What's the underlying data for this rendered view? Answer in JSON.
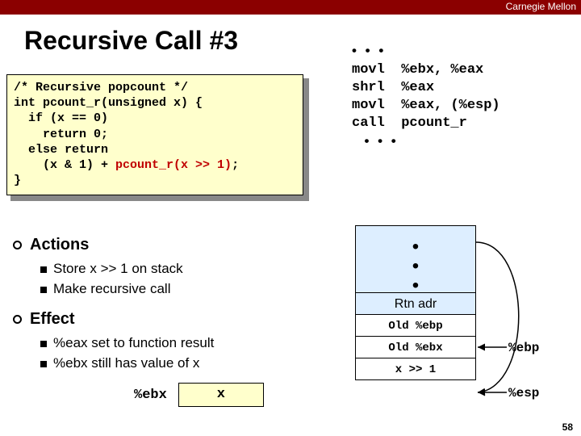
{
  "header": {
    "brand": "Carnegie Mellon"
  },
  "title": "Recursive Call #3",
  "code": {
    "l1": "/* Recursive popcount */",
    "l2": "int pcount_r(unsigned x) {",
    "l3": "  if (x == 0)",
    "l4": "    return 0;",
    "l5": "  else return",
    "l6a": "    (x & 1) + ",
    "l6b": "pcount_r(x >> 1)",
    "l6c": ";",
    "l7": "}"
  },
  "asm": {
    "dots_top": "• • •",
    "l1": "movl  %ebx, %eax",
    "l2": "shrl  %eax",
    "l3": "movl  %eax, (%esp)",
    "l4": "call  pcount_r",
    "dots_bot": "  • • •"
  },
  "sections": {
    "actions": {
      "heading": "Actions",
      "b1": "Store x >> 1 on stack",
      "b2": "Make recursive call"
    },
    "effect": {
      "heading": "Effect",
      "b1": "%eax set to function result",
      "b2": "%ebx still has value of x"
    }
  },
  "reg": {
    "label": "%ebx",
    "value": "x"
  },
  "stack": {
    "dots": "•\n•\n•",
    "rtn": "Rtn adr",
    "oldebp": "Old %ebp",
    "oldebx": "Old %ebx",
    "arg": "x >> 1"
  },
  "ptr": {
    "ebp": "%ebp",
    "esp": "%esp"
  },
  "page": "58"
}
